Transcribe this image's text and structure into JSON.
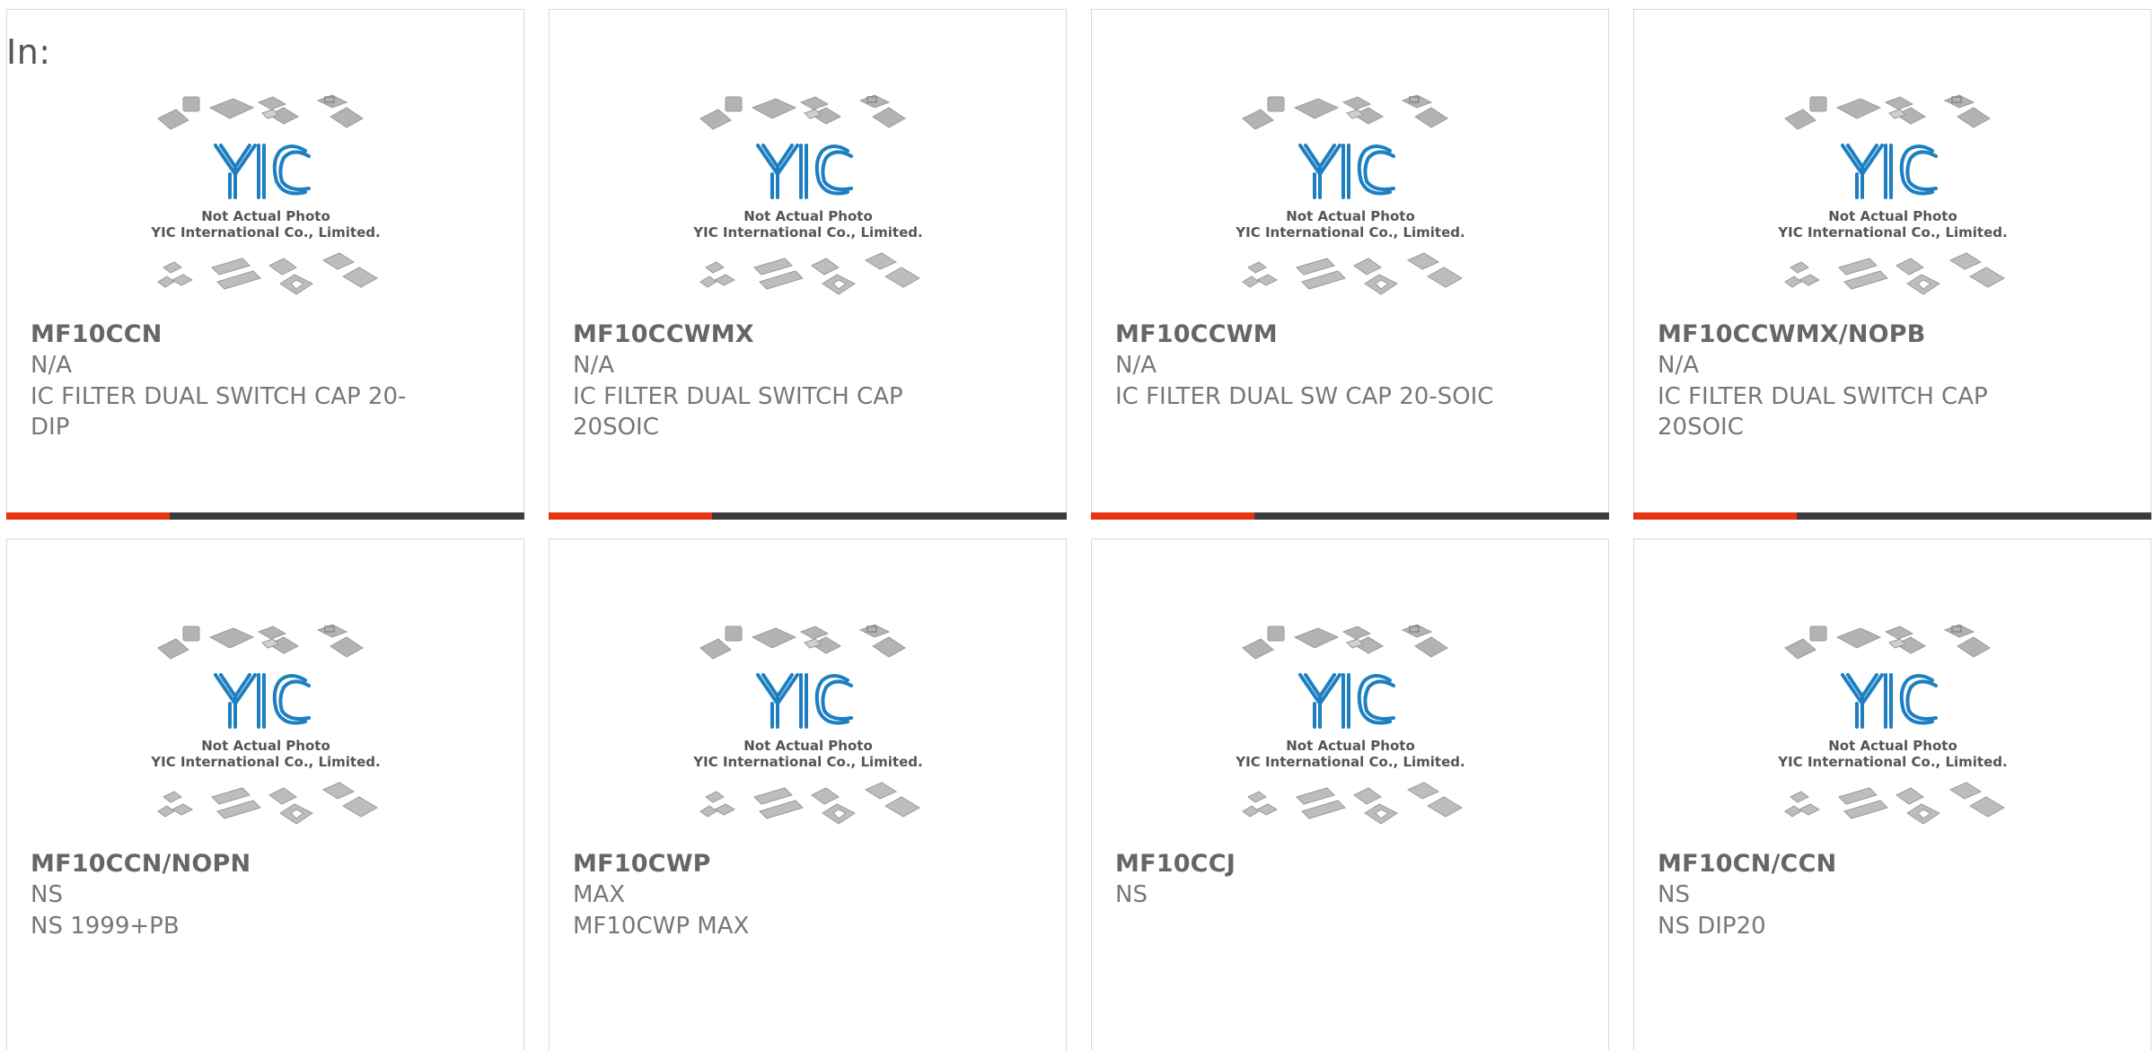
{
  "heading": "In:",
  "photo_text": {
    "line1": "Not Actual Photo",
    "line2": "YIC International Co., Limited.",
    "logo": "YIC"
  },
  "colors": {
    "accent": "#e63312",
    "bar": "#3d3d3d",
    "logo_blue": "#1d7fc1"
  },
  "products": [
    {
      "part": "MF10CCN",
      "manufacturer": "N/A",
      "description": "IC FILTER DUAL SWITCH CAP 20-DIP"
    },
    {
      "part": "MF10CCWMX",
      "manufacturer": "N/A",
      "description": "IC FILTER DUAL SWITCH CAP 20SOIC"
    },
    {
      "part": "MF10CCWM",
      "manufacturer": "N/A",
      "description": "IC FILTER DUAL SW CAP 20-SOIC"
    },
    {
      "part": "MF10CCWMX/NOPB",
      "manufacturer": "N/A",
      "description": "IC FILTER DUAL SWITCH CAP 20SOIC"
    },
    {
      "part": "MF10CCN/NOPN",
      "manufacturer": "NS",
      "description": "NS 1999+PB"
    },
    {
      "part": "MF10CWP",
      "manufacturer": "MAX",
      "description": "MF10CWP MAX"
    },
    {
      "part": "MF10CCJ",
      "manufacturer": "NS",
      "description": ""
    },
    {
      "part": "MF10CN/CCN",
      "manufacturer": "NS",
      "description": "NS DIP20"
    }
  ]
}
